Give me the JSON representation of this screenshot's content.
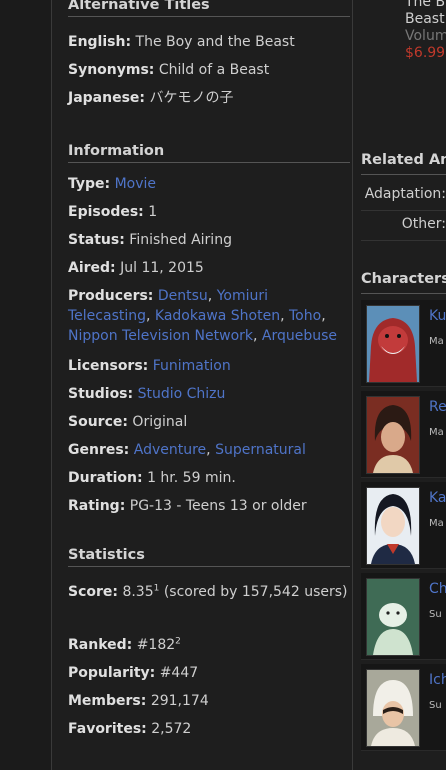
{
  "alt_titles": {
    "heading": "Alternative Titles",
    "english_label": "English:",
    "english": "The Boy and the Beast",
    "synonyms_label": "Synonyms:",
    "synonyms": "Child of a Beast",
    "japanese_label": "Japanese:",
    "japanese": "バケモノの子"
  },
  "information": {
    "heading": "Information",
    "type_label": "Type:",
    "type": "Movie",
    "episodes_label": "Episodes:",
    "episodes": "1",
    "status_label": "Status:",
    "status": "Finished Airing",
    "aired_label": "Aired:",
    "aired": "Jul 11, 2015",
    "producers_label": "Producers:",
    "producers": [
      "Dentsu",
      "Yomiuri Telecasting",
      "Kadokawa Shoten",
      "Toho",
      "Nippon Television Network",
      "Arquebuse"
    ],
    "licensors_label": "Licensors:",
    "licensors": "Funimation",
    "studios_label": "Studios:",
    "studios": "Studio Chizu",
    "source_label": "Source:",
    "source": "Original",
    "genres_label": "Genres:",
    "genres": [
      "Adventure",
      "Supernatural"
    ],
    "duration_label": "Duration:",
    "duration": "1 hr. 59 min.",
    "rating_label": "Rating:",
    "rating": "PG-13 - Teens 13 or older"
  },
  "statistics": {
    "heading": "Statistics",
    "score_label": "Score:",
    "score": "8.35",
    "score_sup": "1",
    "score_note": "(scored by 157,542 users)",
    "ranked_label": "Ranked:",
    "ranked": "#182",
    "ranked_sup": "2",
    "popularity_label": "Popularity:",
    "popularity": "#447",
    "members_label": "Members:",
    "members": "291,174",
    "favorites_label": "Favorites:",
    "favorites": "2,572"
  },
  "store": {
    "title_line1": "The B",
    "title_line2": "Beast",
    "volume": "Volum",
    "price": "$6.99"
  },
  "related": {
    "heading": "Related An",
    "rows": [
      {
        "label": "Adaptation:"
      },
      {
        "label": "Other:"
      }
    ]
  },
  "characters": {
    "heading": "Characters",
    "items": [
      {
        "name": "Ku",
        "role": "Ma",
        "palette": "red"
      },
      {
        "name": "Re",
        "role": "Ma",
        "palette": "brown"
      },
      {
        "name": "Ka",
        "role": "Ma",
        "palette": "school"
      },
      {
        "name": "Ch",
        "role": "Su",
        "palette": "green"
      },
      {
        "name": "Ich",
        "role": "Su",
        "palette": "boar"
      }
    ]
  }
}
